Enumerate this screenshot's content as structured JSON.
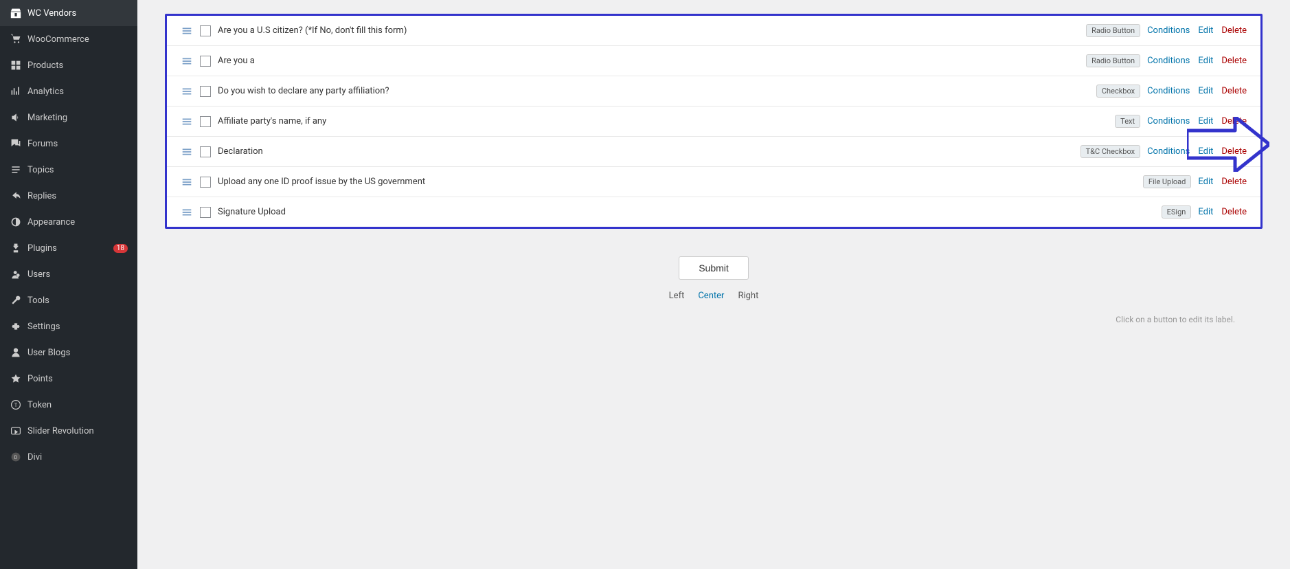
{
  "sidebar": {
    "items": [
      {
        "id": "wc-vendors",
        "label": "WC Vendors",
        "icon": "store-icon"
      },
      {
        "id": "woocommerce",
        "label": "WooCommerce",
        "icon": "cart-icon"
      },
      {
        "id": "products",
        "label": "Products",
        "icon": "products-icon"
      },
      {
        "id": "analytics",
        "label": "Analytics",
        "icon": "analytics-icon"
      },
      {
        "id": "marketing",
        "label": "Marketing",
        "icon": "megaphone-icon"
      },
      {
        "id": "forums",
        "label": "Forums",
        "icon": "forums-icon"
      },
      {
        "id": "topics",
        "label": "Topics",
        "icon": "topics-icon"
      },
      {
        "id": "replies",
        "label": "Replies",
        "icon": "replies-icon"
      },
      {
        "id": "appearance",
        "label": "Appearance",
        "icon": "appearance-icon"
      },
      {
        "id": "plugins",
        "label": "Plugins",
        "icon": "plugins-icon",
        "badge": "18"
      },
      {
        "id": "users",
        "label": "Users",
        "icon": "users-icon"
      },
      {
        "id": "tools",
        "label": "Tools",
        "icon": "tools-icon"
      },
      {
        "id": "settings",
        "label": "Settings",
        "icon": "settings-icon"
      },
      {
        "id": "user-blogs",
        "label": "User Blogs",
        "icon": "user-blogs-icon"
      },
      {
        "id": "points",
        "label": "Points",
        "icon": "points-icon"
      },
      {
        "id": "token",
        "label": "Token",
        "icon": "token-icon"
      },
      {
        "id": "slider-revolution",
        "label": "Slider Revolution",
        "icon": "slider-icon"
      },
      {
        "id": "divi",
        "label": "Divi",
        "icon": "divi-icon"
      }
    ]
  },
  "form_rows": [
    {
      "id": "row-1",
      "label": "Are you a U.S citizen? (*If No, don't fill this form)",
      "field_type": "Radio Button",
      "actions": [
        "Conditions",
        "Edit",
        "Delete"
      ]
    },
    {
      "id": "row-2",
      "label": "Are you a",
      "field_type": "Radio Button",
      "actions": [
        "Conditions",
        "Edit",
        "Delete"
      ]
    },
    {
      "id": "row-3",
      "label": "Do you wish to declare any party affiliation?",
      "field_type": "Checkbox",
      "actions": [
        "Conditions",
        "Edit",
        "Delete"
      ]
    },
    {
      "id": "row-4",
      "label": "Affiliate party's name, if any",
      "field_type": "Text",
      "actions": [
        "Conditions",
        "Edit",
        "Delete"
      ]
    },
    {
      "id": "row-5",
      "label": "Declaration",
      "field_type": "T&C Checkbox",
      "actions": [
        "Conditions",
        "Edit",
        "Delete"
      ]
    },
    {
      "id": "row-6",
      "label": "Upload any one ID proof issue by the US government",
      "field_type": "File Upload",
      "actions": [
        "Edit",
        "Delete"
      ]
    },
    {
      "id": "row-7",
      "label": "Signature Upload",
      "field_type": "ESign",
      "actions": [
        "Edit",
        "Delete"
      ]
    }
  ],
  "submit": {
    "button_label": "Submit",
    "alignment_options": [
      "Left",
      "Center",
      "Right"
    ],
    "active_alignment": "Center",
    "hint": "Click on a button to edit its label."
  },
  "colors": {
    "border_accent": "#3333cc",
    "arrow_color": "#3333cc",
    "action_conditions": "#0073aa",
    "action_edit": "#0073aa",
    "action_delete": "#a00"
  }
}
